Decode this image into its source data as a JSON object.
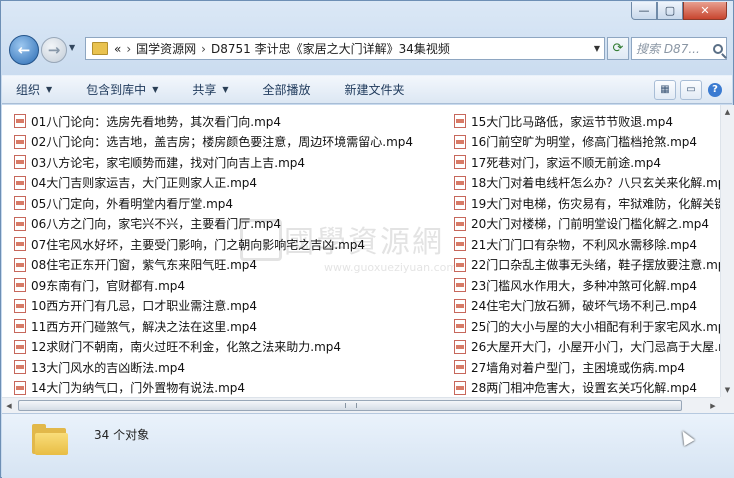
{
  "window": {
    "caption_buttons": [
      "—",
      "▢",
      "✕"
    ]
  },
  "nav": {
    "back_icon": "arrow-left-icon",
    "forward_icon": "arrow-right-icon"
  },
  "address": {
    "prefix": "«",
    "crumbs": [
      "国学资源网",
      "D8751 李计忠《家居之大门详解》34集视频"
    ],
    "separator": "›"
  },
  "search": {
    "placeholder": "搜索 D87..."
  },
  "toolbar": {
    "organize": "组织",
    "include_in_library": "包含到库中",
    "share": "共享",
    "play_all": "全部播放",
    "new_folder": "新建文件夹"
  },
  "files_left": [
    "01八门论向：选房先看地势，其次看门向.mp4",
    "02八门论向：选吉地，盖吉房；楼房颜色要注意，周边环境需留心.mp4",
    "03八方论宅，家宅顺势而建，找对门向吉上吉.mp4",
    "04大门吉则家运吉，大门正则家人正.mp4",
    "05八门定向，外看明堂内看厅堂.mp4",
    "06八方之门向，家宅兴不兴，主要看门厅.mp4",
    "07住宅风水好坏，主要受门影响，门之朝向影响宅之吉凶.mp4",
    "08住宅正东开门窗，紫气东来阳气旺.mp4",
    "09东南有门，官财都有.mp4",
    "10西方开门有几忌，口才职业需注意.mp4",
    "11西方开门碰煞气，解决之法在这里.mp4",
    "12求财门不朝南，南火过旺不利金，化煞之法来助力.mp4",
    "13大门风水的吉凶断法.mp4",
    "14大门为纳气口，门外置物有说法.mp4"
  ],
  "files_right": [
    "15大门比马路低，家运节节败退.mp4",
    "16门前空旷为明堂，修高门槛档抢煞.mp4",
    "17死巷对门，家运不顺无前途.mp4",
    "18大门对着电线杆怎么办？八只玄关来化解.mp4",
    "19大门对电梯，伤灾易有，牢狱难防，化解关键.mp4",
    "20大门对楼梯，门前明堂设门槛化解之.mp4",
    "21大门门口有杂物，不利风水需移除.mp4",
    "22门口杂乱主做事无头绪，鞋子摆放要注意.mp4",
    "23门槛风水作用大，多种冲煞可化解.mp4",
    "24住宅大门放石狮，破坏气场不利己.mp4",
    "25门的大小与屋的大小相配有利于家宅风水.mp4",
    "26大屋开大门，小屋开小门，大门忌高于大屋.mp4",
    "27墙角对着户型门，主困境或伤病.mp4",
    "28两门相冲危害大，设置玄关巧化解.mp4"
  ],
  "file_icon": "mp4-file-icon",
  "watermark": {
    "cn": "國學資源網",
    "en": "www.guoxueziyuan.com"
  },
  "status": {
    "count_label": "34 个对象"
  }
}
